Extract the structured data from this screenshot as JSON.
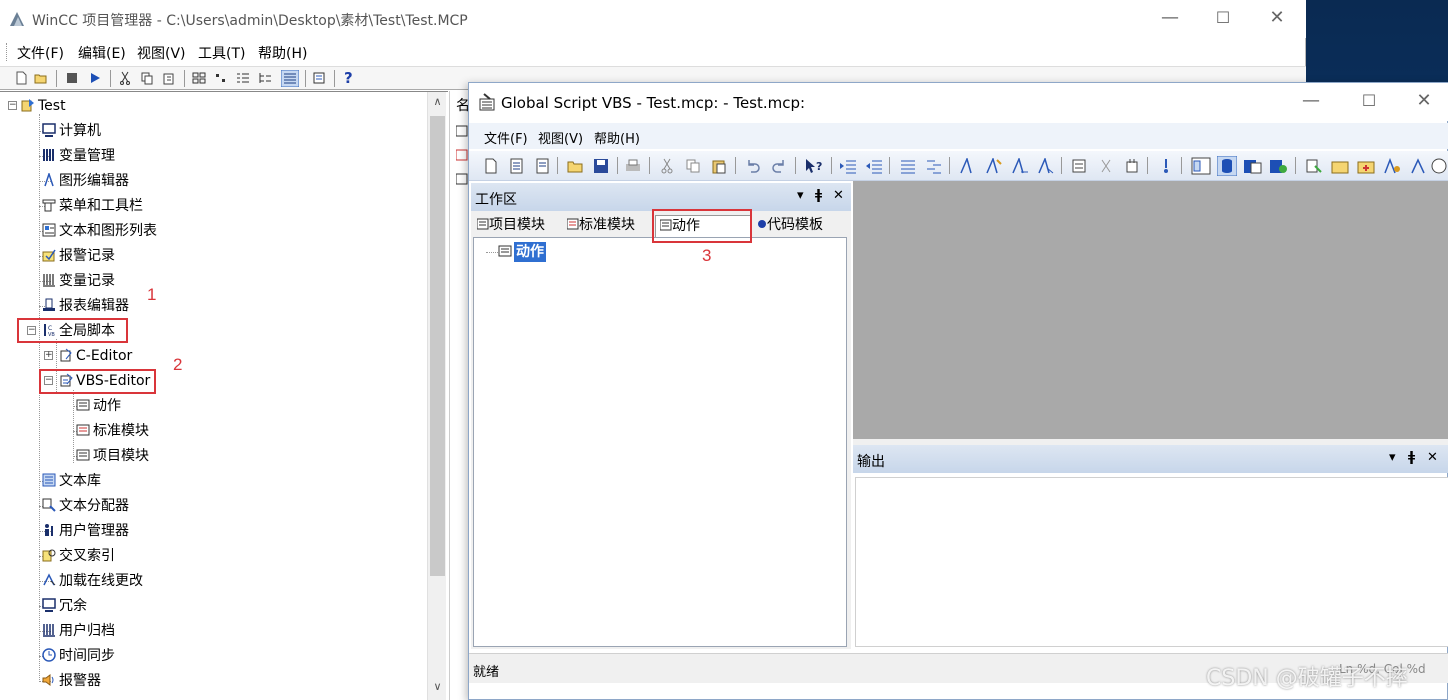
{
  "main_window": {
    "title": "WinCC 项目管理器 - C:\\Users\\admin\\Desktop\\素材\\Test\\Test.MCP",
    "minimize": "—",
    "maximize": "☐",
    "close": "✕",
    "menu": [
      "文件(F)",
      "编辑(E)",
      "视图(V)",
      "工具(T)",
      "帮助(H)"
    ],
    "help_icon": "?"
  },
  "tree": {
    "root": "Test",
    "items": [
      "计算机",
      "变量管理",
      "图形编辑器",
      "菜单和工具栏",
      "文本和图形列表",
      "报警记录",
      "变量记录",
      "报表编辑器",
      "全局脚本",
      "C-Editor",
      "VBS-Editor",
      "动作",
      "标准模块",
      "项目模块",
      "文本库",
      "文本分配器",
      "用户管理器",
      "交叉索引",
      "加载在线更改",
      "冗余",
      "用户归档",
      "时间同步",
      "报警器"
    ],
    "scroll_up": "∧",
    "scroll_down": "∨",
    "right_col_header": "名"
  },
  "annotations": [
    "1",
    "2",
    "3"
  ],
  "vbs_window": {
    "title": "Global Script VBS - Test.mcp: - Test.mcp:",
    "minimize": "—",
    "maximize": "☐",
    "close": "✕",
    "menu": [
      "文件(F)",
      "视图(V)",
      "帮助(H)"
    ],
    "workspace": {
      "title": "工作区",
      "controls": [
        "▾",
        "ǂ",
        "✕"
      ],
      "tabs": [
        "项目模块",
        "标准模块",
        "动作",
        "代码模板"
      ],
      "selected_node": "动作"
    },
    "output": {
      "title": "输出",
      "controls": [
        "▾",
        "ǂ",
        "✕"
      ]
    },
    "status_text": "就绪",
    "status_pos": "Ln %d, Col %d"
  },
  "watermark": "CSDN @破罐子不摔",
  "colors": {
    "accent": "#2f6fd1",
    "annotation": "#d9353a",
    "gray_area": "#a9a9a9"
  }
}
